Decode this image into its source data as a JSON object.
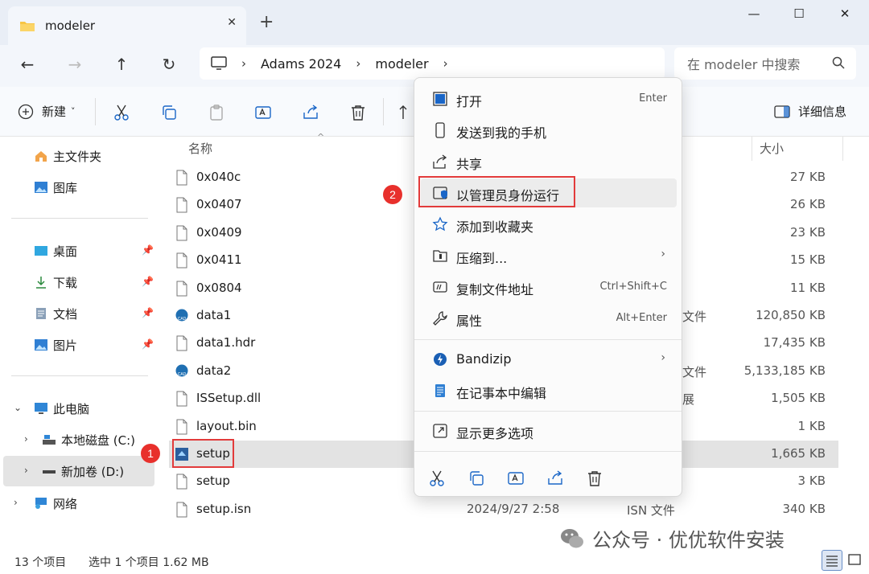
{
  "window": {
    "tab_title": "modeler",
    "tab_close": "✕",
    "new_tab": "+",
    "minimize": "—",
    "maximize": "☐",
    "close": "✕"
  },
  "nav": {
    "back": "←",
    "forward": "→",
    "up": "↑",
    "refresh": "↻",
    "breadcrumbs": [
      "Adams 2024",
      "modeler"
    ],
    "sep": "›",
    "search_placeholder": "在 modeler 中搜索"
  },
  "toolbar": {
    "new_label": "新建",
    "new_caret": "˅",
    "details_label": "详细信息"
  },
  "sidebar": {
    "home": "主文件夹",
    "gallery": "图库",
    "desktop": "桌面",
    "downloads": "下载",
    "documents": "文档",
    "pictures": "图片",
    "pin": "📌",
    "this_pc": "此电脑",
    "drive_c": "本地磁盘 (C:)",
    "drive_d": "新加卷 (D:)",
    "network": "网络"
  },
  "filelist": {
    "col_name": "名称",
    "col_size": "大小",
    "rows": [
      {
        "name": "0x040c",
        "size": "27 KB",
        "date": "",
        "type": ""
      },
      {
        "name": "0x0407",
        "size": "26 KB",
        "date": "",
        "type": ""
      },
      {
        "name": "0x0409",
        "size": "23 KB",
        "date": "",
        "type": ""
      },
      {
        "name": "0x0411",
        "size": "15 KB",
        "date": "",
        "type": ""
      },
      {
        "name": "0x0804",
        "size": "11 KB",
        "date": "",
        "type": ""
      },
      {
        "name": "data1",
        "size": "120,850 KB",
        "date": "",
        "type": "文件"
      },
      {
        "name": "data1.hdr",
        "size": "17,435 KB",
        "date": "",
        "type": ""
      },
      {
        "name": "data2",
        "size": "5,133,185 KB",
        "date": "",
        "type": "文件"
      },
      {
        "name": "ISSetup.dll",
        "size": "1,505 KB",
        "date": "",
        "type": "展"
      },
      {
        "name": "layout.bin",
        "size": "1 KB",
        "date": "",
        "type": ""
      },
      {
        "name": "setup",
        "size": "1,665 KB",
        "date": "",
        "type": ""
      },
      {
        "name": "setup",
        "size": "3 KB",
        "date": "",
        "type": ""
      },
      {
        "name": "setup.isn",
        "size": "340 KB",
        "date": "2024/9/27 2:58",
        "type": "ISN 文件"
      }
    ]
  },
  "status": {
    "count": "13 个项目",
    "selected": "选中 1 个项目  1.62 MB"
  },
  "context_menu": {
    "items": [
      {
        "label": "打开",
        "shortcut": "Enter"
      },
      {
        "label": "发送到我的手机",
        "shortcut": ""
      },
      {
        "label": "共享",
        "shortcut": ""
      },
      {
        "label": "以管理员身份运行",
        "shortcut": ""
      },
      {
        "label": "添加到收藏夹",
        "shortcut": ""
      },
      {
        "label": "压缩到...",
        "shortcut": ""
      },
      {
        "label": "复制文件地址",
        "shortcut": "Ctrl+Shift+C"
      },
      {
        "label": "属性",
        "shortcut": "Alt+Enter"
      },
      {
        "label": "Bandizip",
        "shortcut": ""
      },
      {
        "label": "在记事本中编辑",
        "shortcut": ""
      },
      {
        "label": "显示更多选项",
        "shortcut": ""
      }
    ],
    "arrow": "›"
  },
  "annotations": {
    "badge1": "1",
    "badge2": "2"
  },
  "watermark": "公众号 · 优优软件安装"
}
